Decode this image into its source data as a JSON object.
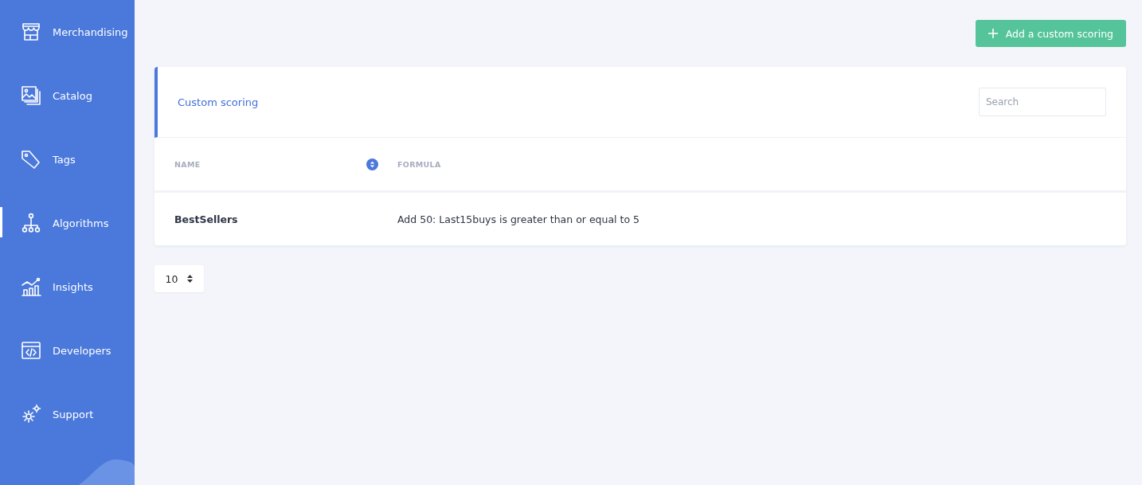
{
  "sidebar": {
    "items": [
      {
        "label": "Merchandising",
        "selected": false
      },
      {
        "label": "Catalog",
        "selected": false
      },
      {
        "label": "Tags",
        "selected": false
      },
      {
        "label": "Algorithms",
        "selected": true
      },
      {
        "label": "Insights",
        "selected": false
      },
      {
        "label": "Developers",
        "selected": false
      },
      {
        "label": "Support",
        "selected": false
      }
    ]
  },
  "add_button": {
    "label": "Add a custom scoring"
  },
  "card": {
    "title": "Custom scoring",
    "search": {
      "placeholder": "Search"
    }
  },
  "table": {
    "columns": [
      {
        "label": "NAME",
        "sortable": true
      },
      {
        "label": "FORMULA",
        "sortable": false
      }
    ],
    "rows": [
      {
        "name": "BestSellers",
        "formula": "Add 50: Last15buys is greater than or equal to 5"
      }
    ]
  },
  "page_size": {
    "value": "10"
  }
}
